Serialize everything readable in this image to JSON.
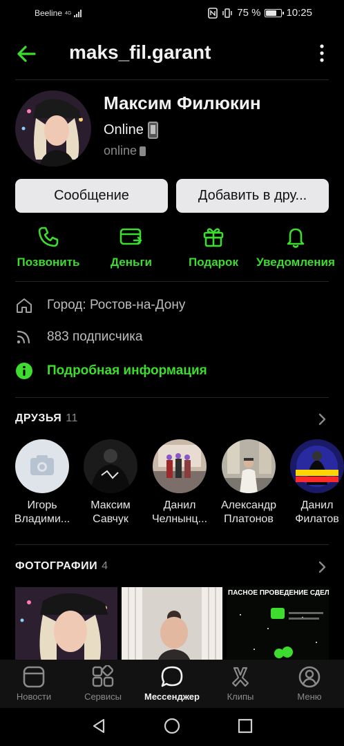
{
  "status_bar": {
    "carrier": "Beeline",
    "network": "4G",
    "battery": "75 %",
    "battery_level": 0.75,
    "time": "10:25"
  },
  "header": {
    "title": "maks_fil.garant",
    "back_icon": "arrow-left-icon",
    "menu_icon": "more-vertical-icon"
  },
  "profile": {
    "name": "Максим Филюкин",
    "status": "Online",
    "status_emoji": "mobile-phone-emoji",
    "presence": "online",
    "presence_icon": "mobile-phone-icon"
  },
  "buttons": {
    "message": "Сообщение",
    "add_friend": "Добавить в дру..."
  },
  "actions": [
    {
      "label": "Позвонить",
      "icon": "phone-icon"
    },
    {
      "label": "Деньги",
      "icon": "money-transfer-icon"
    },
    {
      "label": "Подарок",
      "icon": "gift-icon"
    },
    {
      "label": "Уведомления",
      "icon": "bell-icon"
    }
  ],
  "info": {
    "city": "Город: Ростов-на-Дону",
    "followers": "883 подписчика",
    "details_link": "Подробная информация"
  },
  "friends": {
    "title": "ДРУЗЬЯ",
    "count": "11",
    "items": [
      {
        "line1": "Игорь",
        "line2": "Владими..."
      },
      {
        "line1": "Максим",
        "line2": "Савчук"
      },
      {
        "line1": "Данил",
        "line2": "Челнынц..."
      },
      {
        "line1": "Александр",
        "line2": "Платонов"
      },
      {
        "line1": "Данил",
        "line2": "Филатов"
      }
    ]
  },
  "photos": {
    "title": "ФОТОГРАФИИ",
    "count": "4",
    "overlay_text": "ПАСНОЕ ПРОВЕДЕНИЕ СДЕЛ"
  },
  "tabbar": {
    "items": [
      {
        "label": "Новости",
        "icon": "news-icon"
      },
      {
        "label": "Сервисы",
        "icon": "services-grid-icon"
      },
      {
        "label": "Мессенджер",
        "icon": "messenger-bubble-icon",
        "active": true
      },
      {
        "label": "Клипы",
        "icon": "clips-icon"
      },
      {
        "label": "Меню",
        "icon": "profile-menu-icon"
      }
    ]
  },
  "colors": {
    "accent": "#3ddc2e",
    "background": "#000000",
    "button_bg": "#e8e8ea",
    "tabbar_bg": "#121212"
  }
}
